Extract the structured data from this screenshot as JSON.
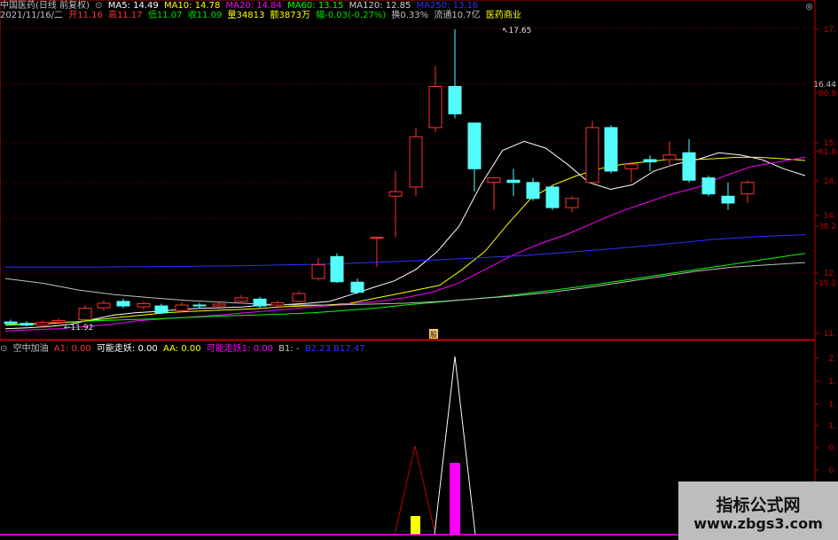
{
  "header": {
    "stock_name": "中国医药(日线 前复权)",
    "ma5": "MA5: 14.49",
    "ma10": "MA10: 14.78",
    "ma20": "MA20: 14.84",
    "ma60": "MA60: 13.15",
    "ma120": "MA120: 12.85",
    "ma250": "MA250: 13.16"
  },
  "quote": {
    "date": "2021/11/16/二",
    "open": "开11.16",
    "high": "高11.17",
    "low": "低11.07",
    "close": "收11.09",
    "volume": "量34813",
    "amount": "额3873万",
    "change": "幅-0.03(-0.27%)",
    "turnover": "换0.33%",
    "float_cap": "流通10.7亿",
    "industry": "医药商业"
  },
  "indicator": {
    "name": "空中加油",
    "a1": "A1: 0.00",
    "kn": "可能走妖: 0.00",
    "aa": "AA: 0.00",
    "kn1": "可能走妖1: 0.00",
    "b1": "B1: -",
    "hidden": "B2.23 B17.47"
  },
  "price_axis": [
    "17.",
    "16.44",
    "80.9",
    "15.",
    "61.8",
    "14.",
    "14.",
    "38.2",
    "12.",
    "19.1",
    "11."
  ],
  "ind_axis": [
    "2.",
    "1.",
    "1.",
    "1.",
    "0.",
    "0."
  ],
  "annotations": {
    "high_label": "17.65",
    "low_label": "11.92",
    "marker": "股"
  },
  "watermark": {
    "title": "指标公式网",
    "url": "www.zbgs3.com"
  },
  "colors": {
    "up": "#ff3232",
    "down": "#54fcfc",
    "ma5": "#ffffff",
    "ma10": "#ffff00",
    "ma20": "#ff00ff",
    "ma60": "#00ff00",
    "ma120": "#c0c0c0",
    "ma250": "#3030ff",
    "grid": "#800000",
    "axis": "#c00000"
  },
  "candles": [
    {
      "o": 11.25,
      "c": 11.22,
      "h": 11.3,
      "l": 11.18
    },
    {
      "o": 11.22,
      "c": 11.18,
      "h": 11.27,
      "l": 11.15
    },
    {
      "o": 11.18,
      "c": 11.24,
      "h": 11.28,
      "l": 11.12
    },
    {
      "o": 11.24,
      "c": 11.28,
      "h": 11.33,
      "l": 11.2
    },
    {
      "o": 11.3,
      "c": 11.55,
      "h": 11.62,
      "l": 11.28
    },
    {
      "o": 11.56,
      "c": 11.66,
      "h": 11.72,
      "l": 11.5
    },
    {
      "o": 11.7,
      "c": 11.6,
      "h": 11.76,
      "l": 11.55
    },
    {
      "o": 11.58,
      "c": 11.65,
      "h": 11.7,
      "l": 11.52
    },
    {
      "o": 11.6,
      "c": 11.45,
      "h": 11.65,
      "l": 11.42
    },
    {
      "o": 11.5,
      "c": 11.62,
      "h": 11.68,
      "l": 11.45
    },
    {
      "o": 11.62,
      "c": 11.6,
      "h": 11.67,
      "l": 11.56
    },
    {
      "o": 11.6,
      "c": 11.64,
      "h": 11.7,
      "l": 11.57
    },
    {
      "o": 11.7,
      "c": 11.78,
      "h": 11.84,
      "l": 11.65
    },
    {
      "o": 11.75,
      "c": 11.6,
      "h": 11.8,
      "l": 11.56
    },
    {
      "o": 11.62,
      "c": 11.67,
      "h": 11.72,
      "l": 11.58
    },
    {
      "o": 11.7,
      "c": 11.87,
      "h": 11.92,
      "l": 11.68
    },
    {
      "o": 12.2,
      "c": 12.5,
      "h": 12.65,
      "l": 12.15
    },
    {
      "o": 12.68,
      "c": 12.13,
      "h": 12.75,
      "l": 12.1
    },
    {
      "o": 12.12,
      "c": 11.9,
      "h": 12.2,
      "l": 11.86
    },
    {
      "o": 13.1,
      "c": 13.1,
      "h": 13.12,
      "l": 12.45
    },
    {
      "o": 14.0,
      "c": 14.1,
      "h": 14.55,
      "l": 13.1
    },
    {
      "o": 14.2,
      "c": 15.3,
      "h": 15.5,
      "l": 14.0
    },
    {
      "o": 15.5,
      "c": 16.4,
      "h": 16.85,
      "l": 15.4
    },
    {
      "o": 16.4,
      "c": 15.8,
      "h": 17.65,
      "l": 15.7
    },
    {
      "o": 15.6,
      "c": 14.6,
      "h": 15.6,
      "l": 14.1
    },
    {
      "o": 14.3,
      "c": 14.4,
      "h": 14.42,
      "l": 13.7
    },
    {
      "o": 14.35,
      "c": 14.3,
      "h": 14.6,
      "l": 14.0
    },
    {
      "o": 14.3,
      "c": 13.95,
      "h": 14.4,
      "l": 13.9
    },
    {
      "o": 14.2,
      "c": 13.75,
      "h": 14.25,
      "l": 13.7
    },
    {
      "o": 13.75,
      "c": 13.95,
      "h": 14.0,
      "l": 13.65
    },
    {
      "o": 14.3,
      "c": 15.5,
      "h": 15.65,
      "l": 14.25
    },
    {
      "o": 15.5,
      "c": 14.55,
      "h": 15.55,
      "l": 14.5
    },
    {
      "o": 14.6,
      "c": 14.7,
      "h": 14.75,
      "l": 14.3
    },
    {
      "o": 14.8,
      "c": 14.75,
      "h": 14.9,
      "l": 14.55
    },
    {
      "o": 14.8,
      "c": 14.9,
      "h": 15.2,
      "l": 14.65
    },
    {
      "o": 14.95,
      "c": 14.35,
      "h": 15.25,
      "l": 14.3
    },
    {
      "o": 14.4,
      "c": 14.05,
      "h": 14.45,
      "l": 14.0
    },
    {
      "o": 14.0,
      "c": 13.85,
      "h": 14.3,
      "l": 13.7
    },
    {
      "o": 14.05,
      "c": 14.3,
      "h": 14.35,
      "l": 13.85
    }
  ],
  "candle_x": [
    12,
    30,
    48,
    66,
    96,
    117,
    139,
    162,
    182,
    205,
    225,
    247,
    272,
    293,
    313,
    337,
    359,
    380,
    403,
    425,
    446,
    469,
    491,
    513,
    535,
    557,
    579,
    601,
    623,
    645,
    668,
    689,
    712,
    733,
    755,
    777,
    799,
    821,
    843,
    864,
    886,
    908
  ],
  "ma_series": {
    "ma5": [
      11.1,
      11.12,
      11.15,
      11.2,
      11.3,
      11.4,
      11.45,
      11.48,
      11.52,
      11.55,
      11.56,
      11.58,
      11.62,
      11.63,
      11.66,
      11.7,
      11.85,
      12.0,
      12.15,
      12.4,
      12.8,
      13.35,
      14.25,
      15.0,
      15.2,
      15.05,
      14.7,
      14.3,
      14.15,
      14.25,
      14.55,
      14.7,
      14.8,
      14.95,
      14.9,
      14.8,
      14.6,
      14.45
    ],
    "ma10": [
      11.18,
      11.2,
      11.22,
      11.25,
      11.3,
      11.35,
      11.4,
      11.45,
      11.48,
      11.5,
      11.52,
      11.54,
      11.58,
      11.6,
      11.62,
      11.65,
      11.75,
      11.85,
      11.95,
      12.05,
      12.4,
      12.8,
      13.4,
      13.95,
      14.25,
      14.45,
      14.6,
      14.7,
      14.75,
      14.8,
      14.8,
      14.82,
      14.85,
      14.85,
      14.82,
      14.78
    ],
    "ma20": [
      11.05,
      11.08,
      11.1,
      11.15,
      11.2,
      11.28,
      11.32,
      11.36,
      11.4,
      11.45,
      11.5,
      11.55,
      11.6,
      11.65,
      11.7,
      11.78,
      11.9,
      12.1,
      12.4,
      12.7,
      12.95,
      13.15,
      13.4,
      13.65,
      13.85,
      14.05,
      14.2,
      14.45,
      14.65,
      14.75,
      14.85
    ],
    "ma60": [
      11.2,
      11.22,
      11.25,
      11.28,
      11.3,
      11.32,
      11.35,
      11.38,
      11.4,
      11.42,
      11.45,
      11.5,
      11.55,
      11.62,
      11.68,
      11.74,
      11.8,
      11.88,
      11.96,
      12.05,
      12.15,
      12.25,
      12.35,
      12.45,
      12.55,
      12.65,
      12.75
    ],
    "ma120": [
      12.2,
      12.1,
      11.95,
      11.85,
      11.78,
      11.72,
      11.68,
      11.64,
      11.62,
      11.62,
      11.64,
      11.66,
      11.7,
      11.76,
      11.82,
      11.9,
      12.0,
      12.12,
      12.24,
      12.36,
      12.45,
      12.5,
      12.55
    ],
    "ma250": [
      12.45,
      12.45,
      12.45,
      12.46,
      12.47,
      12.48,
      12.5,
      12.52,
      12.56,
      12.6,
      12.65,
      12.7,
      12.78,
      12.86,
      12.95,
      13.05,
      13.12,
      13.16
    ]
  }
}
